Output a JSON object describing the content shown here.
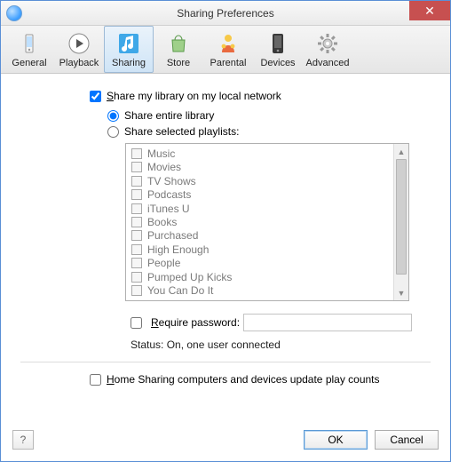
{
  "window": {
    "title": "Sharing Preferences",
    "close_glyph": "✕"
  },
  "tabs": [
    {
      "label": "General",
      "icon": "phone"
    },
    {
      "label": "Playback",
      "icon": "play"
    },
    {
      "label": "Sharing",
      "icon": "music-note",
      "selected": true
    },
    {
      "label": "Store",
      "icon": "bag"
    },
    {
      "label": "Parental",
      "icon": "people"
    },
    {
      "label": "Devices",
      "icon": "device"
    },
    {
      "label": "Advanced",
      "icon": "gear"
    }
  ],
  "share_library_label": "Share my library on my local network",
  "share_entire_label": "Share entire library",
  "share_selected_label": "Share selected playlists:",
  "playlists": [
    "Music",
    "Movies",
    "TV Shows",
    "Podcasts",
    "iTunes U",
    "Books",
    "Purchased",
    "High Enough",
    "People",
    "Pumped Up Kicks",
    "You Can Do It"
  ],
  "require_password_label": "Require password:",
  "status_label": "Status: On, one user connected",
  "home_sharing_label": "Home Sharing computers and devices update play counts",
  "buttons": {
    "help": "?",
    "ok": "OK",
    "cancel": "Cancel"
  },
  "state": {
    "share_library_checked": true,
    "share_mode": "entire",
    "require_password_checked": false,
    "home_sharing_checked": false
  }
}
